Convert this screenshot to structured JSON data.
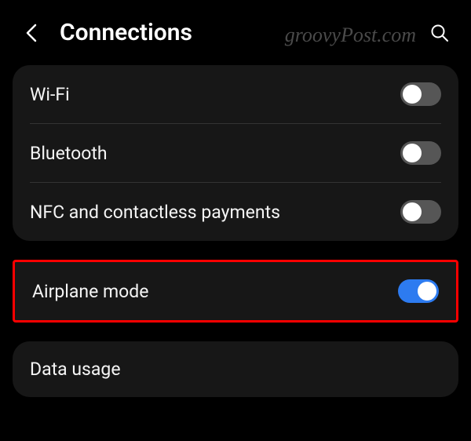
{
  "header": {
    "title": "Connections"
  },
  "groups": [
    {
      "highlighted": false,
      "items": [
        {
          "label": "Wi-Fi",
          "state": "off"
        },
        {
          "label": "Bluetooth",
          "state": "off"
        },
        {
          "label": "NFC and contactless payments",
          "state": "off"
        }
      ]
    },
    {
      "highlighted": true,
      "items": [
        {
          "label": "Airplane mode",
          "state": "on"
        }
      ]
    },
    {
      "highlighted": false,
      "items": [
        {
          "label": "Data usage",
          "state": null
        }
      ]
    }
  ],
  "watermark": "groovyPost.com"
}
